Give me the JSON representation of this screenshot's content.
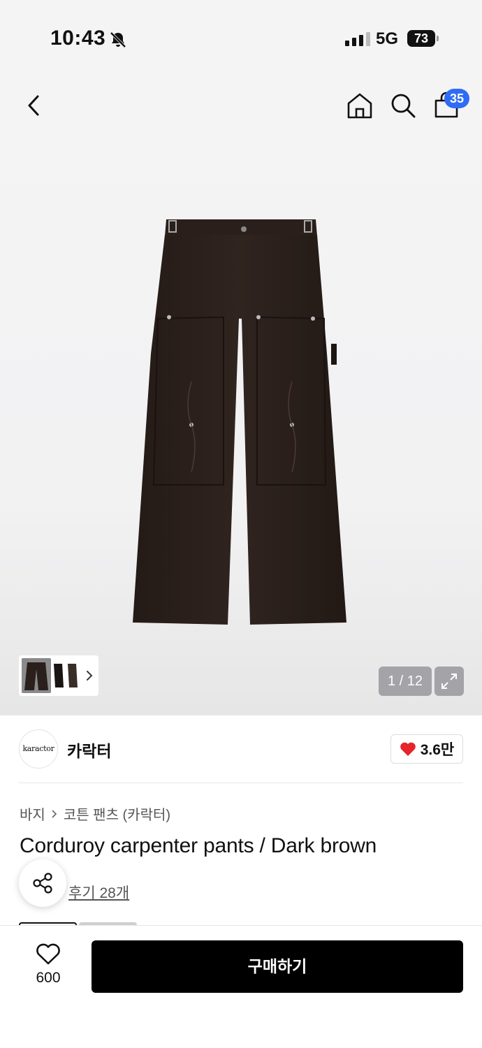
{
  "status_bar": {
    "time": "10:43",
    "network": "5G",
    "battery": "73"
  },
  "header": {
    "cart_badge": "35"
  },
  "gallery": {
    "counter": "1 / 12"
  },
  "brand": {
    "logo_text": "karactor",
    "name": "카락터",
    "likes": "3.6만"
  },
  "breadcrumb": {
    "level1": "바지",
    "level2": "코튼 팬츠 (카락터)"
  },
  "product": {
    "title": "Corduroy carpenter pants / Dark brown",
    "reviews": "후기 28개"
  },
  "bottom_bar": {
    "wish_count": "600",
    "buy_label": "구매하기"
  },
  "colors": {
    "accent_blue": "#2f6cf6",
    "heart_red": "#e5242b",
    "pants_brown": "#2a1f1b",
    "buy_black": "#000000"
  }
}
